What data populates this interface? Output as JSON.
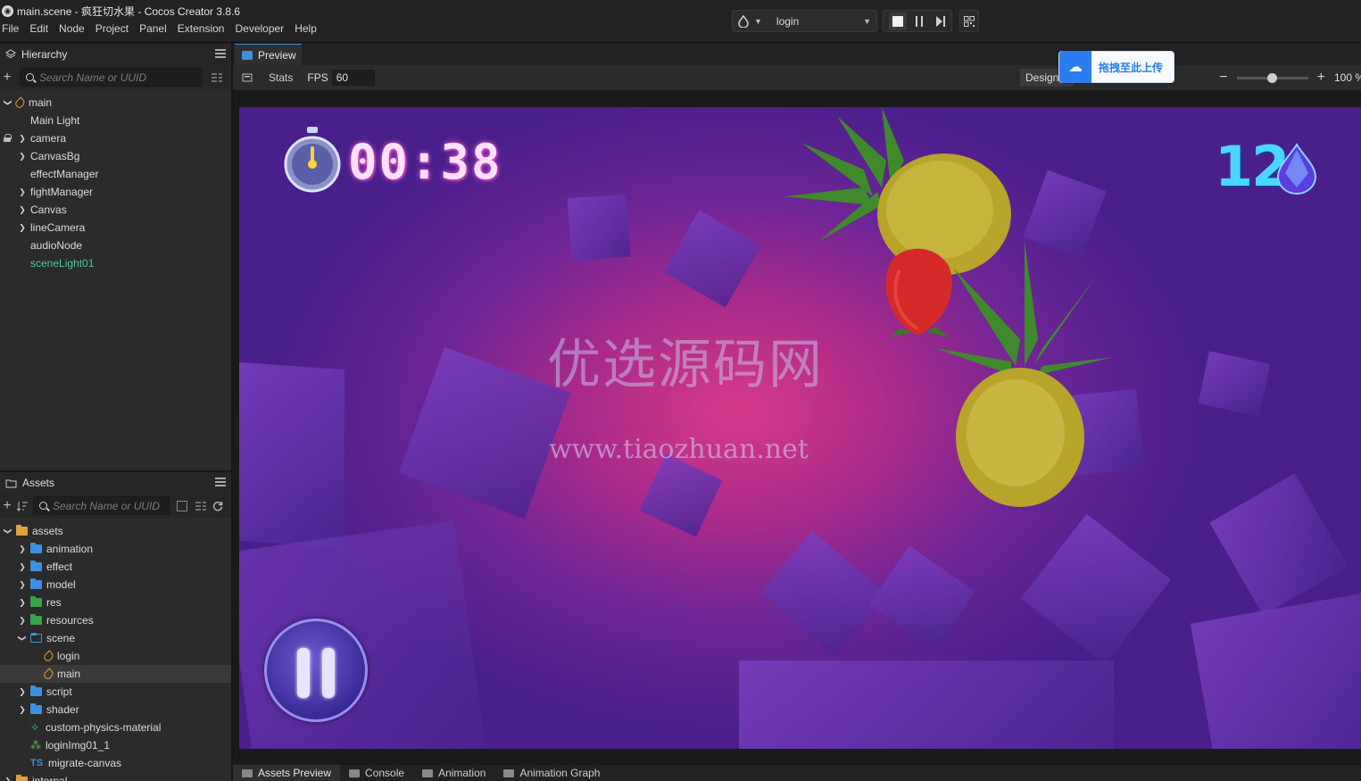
{
  "window": {
    "title": "main.scene - 疯狂切水果 - Cocos Creator 3.8.6"
  },
  "menu": [
    "File",
    "Edit",
    "Node",
    "Project",
    "Panel",
    "Extension",
    "Developer",
    "Help"
  ],
  "toolbar": {
    "scene_select": "login"
  },
  "hierarchy": {
    "title": "Hierarchy",
    "search_placeholder": "Search Name or UUID",
    "items": [
      {
        "label": "main",
        "depth": 0,
        "expand": "open",
        "icon": "scene-icon"
      },
      {
        "label": "Main Light",
        "depth": 1,
        "expand": "none"
      },
      {
        "label": "camera",
        "depth": 1,
        "expand": "closed",
        "locked": true
      },
      {
        "label": "CanvasBg",
        "depth": 1,
        "expand": "closed"
      },
      {
        "label": "effectManager",
        "depth": 1,
        "expand": "none"
      },
      {
        "label": "fightManager",
        "depth": 1,
        "expand": "closed"
      },
      {
        "label": "Canvas",
        "depth": 1,
        "expand": "closed"
      },
      {
        "label": "lineCamera",
        "depth": 1,
        "expand": "closed"
      },
      {
        "label": "audioNode",
        "depth": 1,
        "expand": "none"
      },
      {
        "label": "sceneLight01",
        "depth": 1,
        "expand": "none",
        "color": "#4ec9a0"
      }
    ]
  },
  "assets": {
    "title": "Assets",
    "search_placeholder": "Search Name or UUID",
    "items": [
      {
        "label": "assets",
        "depth": 0,
        "expand": "open",
        "icon": "db-icon"
      },
      {
        "label": "animation",
        "depth": 1,
        "expand": "closed",
        "icon": "folder-icon"
      },
      {
        "label": "effect",
        "depth": 1,
        "expand": "closed",
        "icon": "folder-icon"
      },
      {
        "label": "model",
        "depth": 1,
        "expand": "closed",
        "icon": "folder-icon"
      },
      {
        "label": "res",
        "depth": 1,
        "expand": "closed",
        "icon": "bundle-folder-icon"
      },
      {
        "label": "resources",
        "depth": 1,
        "expand": "closed",
        "icon": "bundle-folder-icon"
      },
      {
        "label": "scene",
        "depth": 1,
        "expand": "open",
        "icon": "open-folder-icon"
      },
      {
        "label": "login",
        "depth": 2,
        "expand": "none",
        "icon": "scene-icon"
      },
      {
        "label": "main",
        "depth": 2,
        "expand": "none",
        "icon": "scene-icon",
        "selected": true
      },
      {
        "label": "script",
        "depth": 1,
        "expand": "closed",
        "icon": "folder-icon"
      },
      {
        "label": "shader",
        "depth": 1,
        "expand": "closed",
        "icon": "folder-icon"
      },
      {
        "label": "custom-physics-material",
        "depth": 1,
        "expand": "none",
        "icon": "physics-material-icon"
      },
      {
        "label": "loginImg01_1",
        "depth": 1,
        "expand": "none",
        "icon": "prefab-icon"
      },
      {
        "label": "migrate-canvas",
        "depth": 1,
        "expand": "none",
        "icon": "typescript-icon"
      },
      {
        "label": "internal",
        "depth": 0,
        "expand": "closed",
        "icon": "db-icon"
      }
    ]
  },
  "preview": {
    "tab_label": "Preview",
    "stats_label": "Stats",
    "fps_label": "FPS",
    "fps_value": "60",
    "design_label": "Design",
    "upload_label": "拖拽至此上传",
    "zoom": "100 %"
  },
  "game": {
    "timer": "00:38",
    "score": "12",
    "watermark_cn": "优选源码网",
    "watermark_url": "www.tiaozhuan.net"
  },
  "bottom_tabs": [
    "Assets Preview",
    "Console",
    "Animation",
    "Animation Graph"
  ]
}
